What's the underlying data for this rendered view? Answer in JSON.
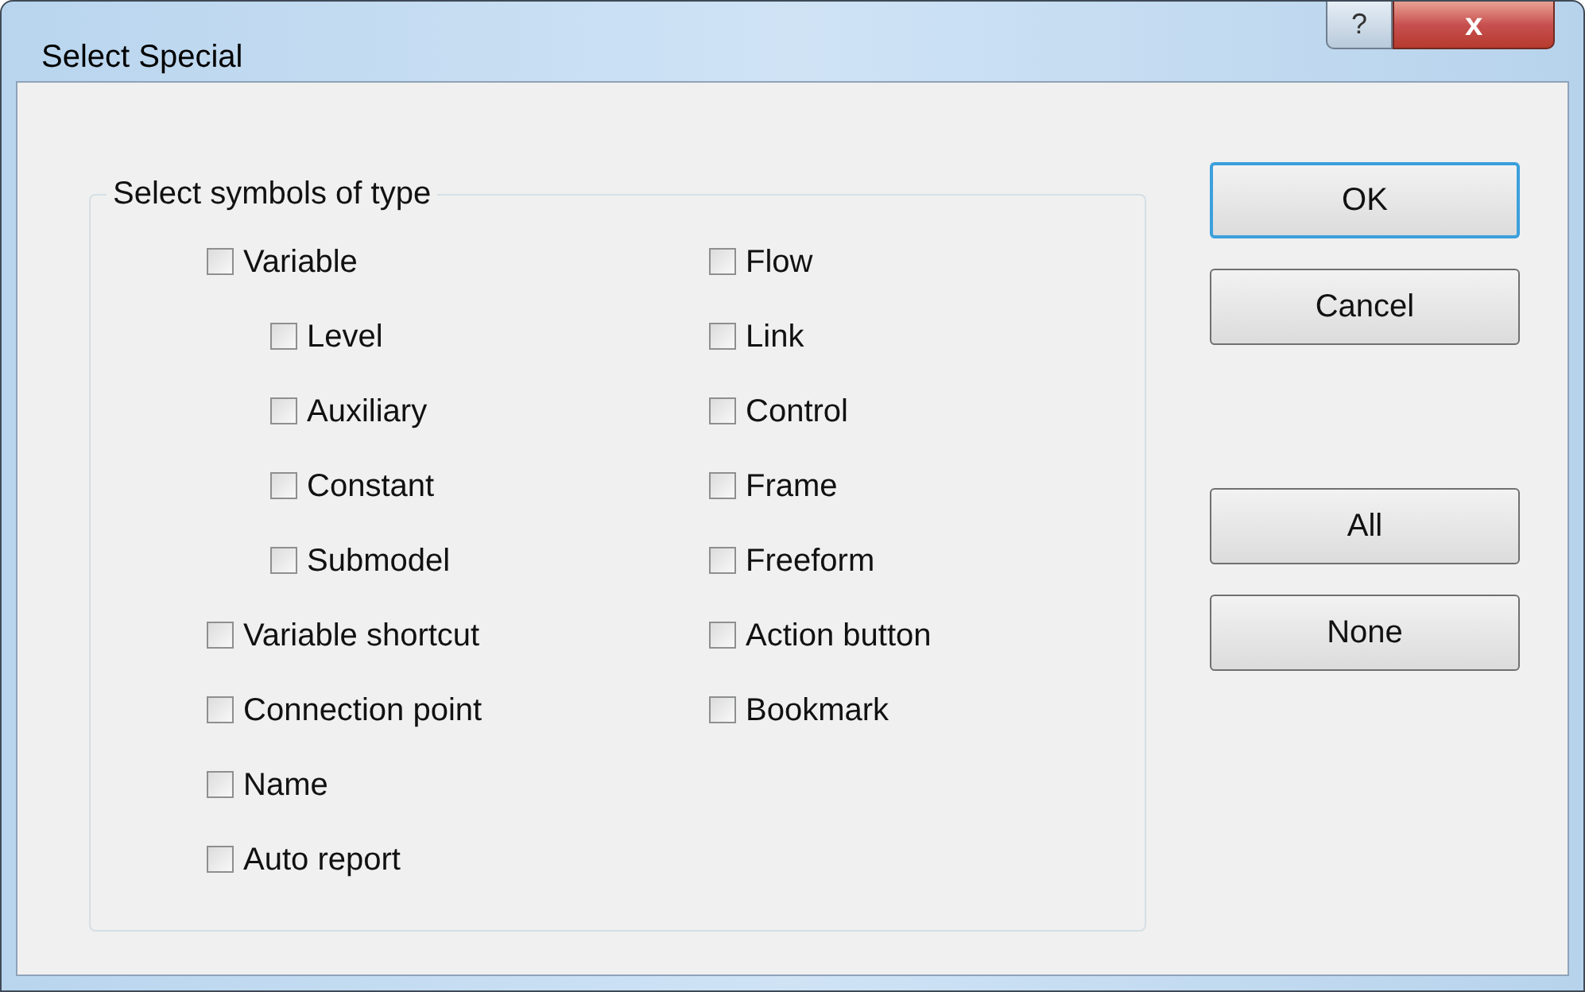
{
  "window": {
    "title": "Select Special",
    "help_button": "?",
    "close_button": "x"
  },
  "group": {
    "title": "Select symbols of type",
    "left": [
      {
        "label": "Variable",
        "checked": false,
        "children": [
          {
            "label": "Level",
            "checked": false
          },
          {
            "label": "Auxiliary",
            "checked": false
          },
          {
            "label": "Constant",
            "checked": false
          },
          {
            "label": "Submodel",
            "checked": false
          }
        ]
      },
      {
        "label": "Variable shortcut",
        "checked": false
      },
      {
        "label": "Connection point",
        "checked": false
      },
      {
        "label": "Name",
        "checked": false
      },
      {
        "label": "Auto report",
        "checked": false
      }
    ],
    "right": [
      {
        "label": "Flow",
        "checked": false
      },
      {
        "label": "Link",
        "checked": false
      },
      {
        "label": "Control",
        "checked": false
      },
      {
        "label": "Frame",
        "checked": false
      },
      {
        "label": "Freeform",
        "checked": false
      },
      {
        "label": "Action button",
        "checked": false
      },
      {
        "label": "Bookmark",
        "checked": false
      }
    ]
  },
  "dialog_buttons": [
    {
      "label": "OK",
      "default": true
    },
    {
      "label": "Cancel",
      "default": false
    }
  ],
  "selection_buttons": [
    {
      "label": "All",
      "default": false
    },
    {
      "label": "None",
      "default": false
    }
  ]
}
